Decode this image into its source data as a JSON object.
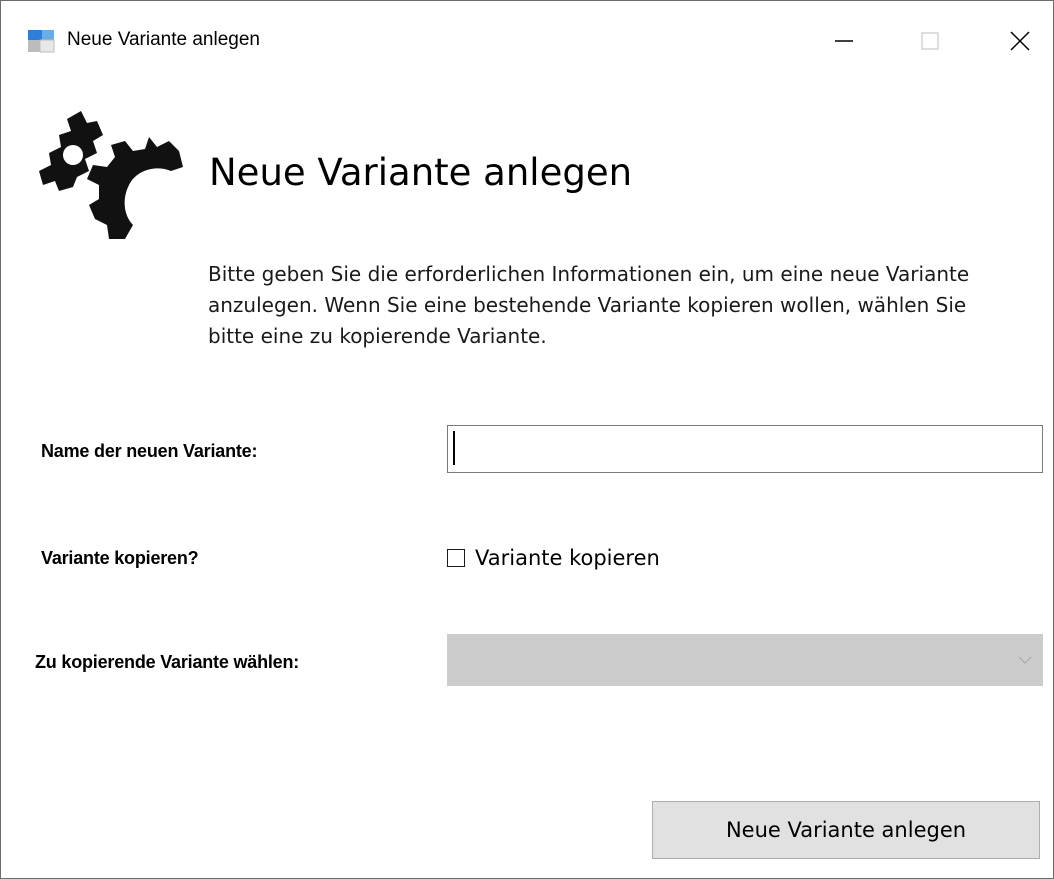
{
  "window": {
    "title": "Neue Variante anlegen",
    "controls": {
      "minimize_glyph": "minimize-icon",
      "maximize_glyph": "maximize-icon",
      "close_glyph": "close-icon"
    }
  },
  "header": {
    "logo_icon": "gears-icon",
    "title": "Neue Variante anlegen",
    "description": "Bitte geben Sie die erforderlichen Informationen ein, um eine neue Variante anzulegen. Wenn Sie eine bestehende Variante kopieren wollen, wählen Sie bitte eine zu kopierende Variante."
  },
  "form": {
    "name": {
      "label": "Name der neuen Variante:",
      "value": ""
    },
    "copy": {
      "label": "Variante kopieren?",
      "checkbox_label": "Variante kopieren",
      "checked": false
    },
    "source_variant": {
      "label": "Zu kopierende Variante wählen:",
      "selected": "",
      "enabled": false
    }
  },
  "actions": {
    "create_label": "Neue Variante anlegen"
  },
  "colors": {
    "disabled_select": "#cccccc",
    "button_bg": "#e1e1e1",
    "button_border": "#adadad",
    "input_border": "#7a7a7a"
  }
}
